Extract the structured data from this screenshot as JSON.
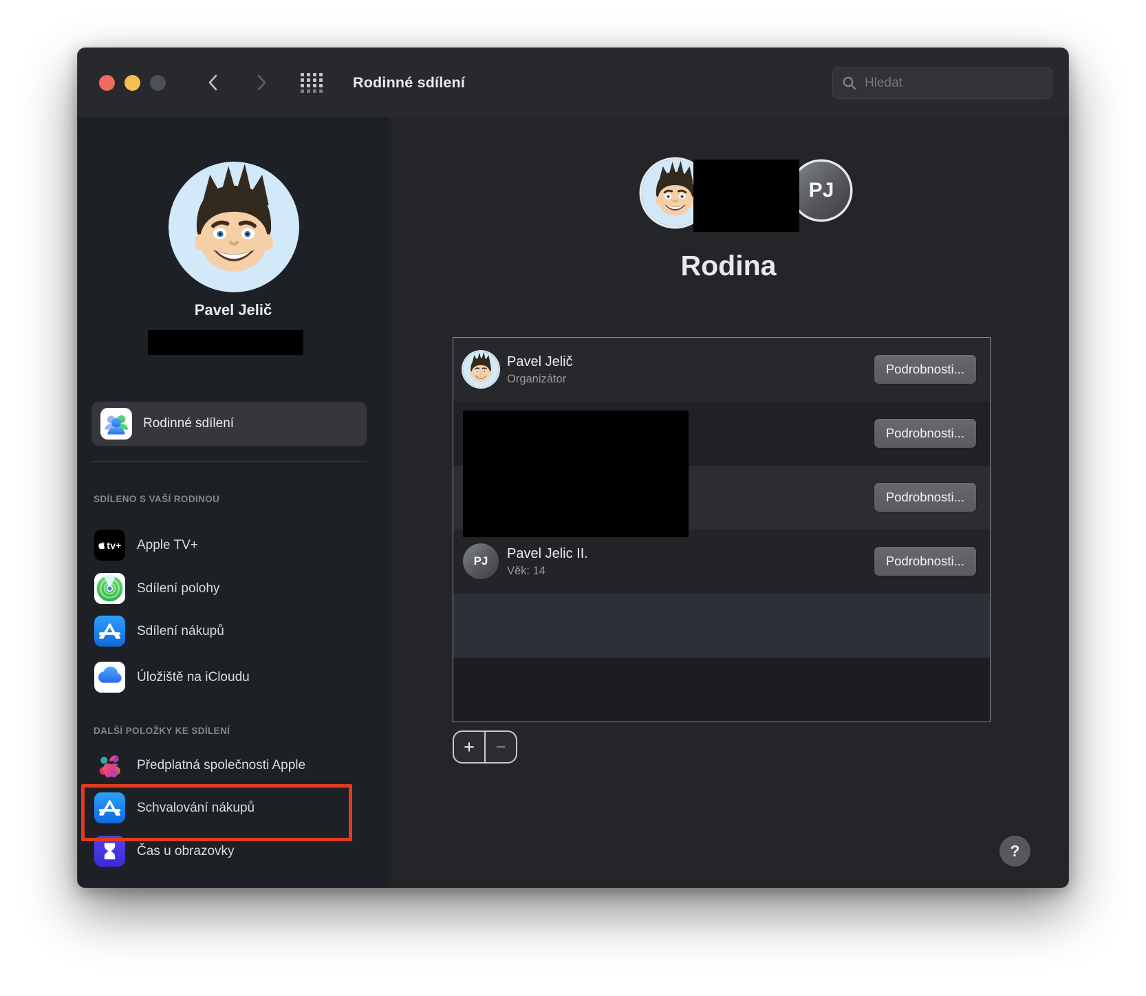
{
  "window": {
    "title": "Rodinné sdílení",
    "search_placeholder": "Hledat"
  },
  "sidebar": {
    "user_name": "Pavel Jelič",
    "primary_item": "Rodinné sdílení",
    "sections": [
      {
        "header": "SDÍLENO S VAŠÍ RODINOU",
        "items": [
          {
            "label": "Apple TV+",
            "icon": "apple-tv-plus-icon"
          },
          {
            "label": "Sdílení polohy",
            "icon": "find-my-icon"
          },
          {
            "label": "Sdílení nákupů",
            "icon": "app-store-icon"
          },
          {
            "label": "Úložiště na iCloudu",
            "icon": "icloud-icon"
          }
        ]
      },
      {
        "header": "DALŠÍ POLOŽKY KE SDÍLENÍ",
        "items": [
          {
            "label": "Předplatná společnosti Apple",
            "icon": "apple-one-icon"
          },
          {
            "label": "Schvalování nákupů",
            "icon": "app-store-icon",
            "highlighted": true
          },
          {
            "label": "Čas u obrazovky",
            "icon": "screen-time-icon"
          }
        ]
      }
    ]
  },
  "main": {
    "heading": "Rodina",
    "cluster_initials": "PJ",
    "members": [
      {
        "name": "Pavel Jelič",
        "subtitle": "Organizátor",
        "button": "Podrobnosti...",
        "avatar": "memoji"
      },
      {
        "name": "",
        "subtitle": "",
        "button": "Podrobnosti...",
        "avatar": "redacted"
      },
      {
        "name": "",
        "subtitle": "",
        "button": "Podrobnosti...",
        "avatar": "redacted"
      },
      {
        "name": "Pavel Jelic II.",
        "subtitle": "Věk: 14",
        "button": "Podrobnosti...",
        "initials": "PJ",
        "avatar": "initials"
      }
    ],
    "add_label": "+",
    "remove_label": "−",
    "help_label": "?"
  },
  "icons": {
    "apple_tv_badge": "tv+",
    "search": "magnifier",
    "back": "chevron-left",
    "forward": "chevron-right",
    "grid": "app-grid"
  },
  "colors": {
    "annotation_red": "#e23a1f",
    "app_store_blue": "#1e8df2",
    "screen_time_indigo": "#4635e4",
    "find_my_green": "#46c954",
    "selected_row": "#35373c",
    "titlebar": "#28292d",
    "sidebar_bg": "#1d2024",
    "main_bg": "#232529"
  }
}
